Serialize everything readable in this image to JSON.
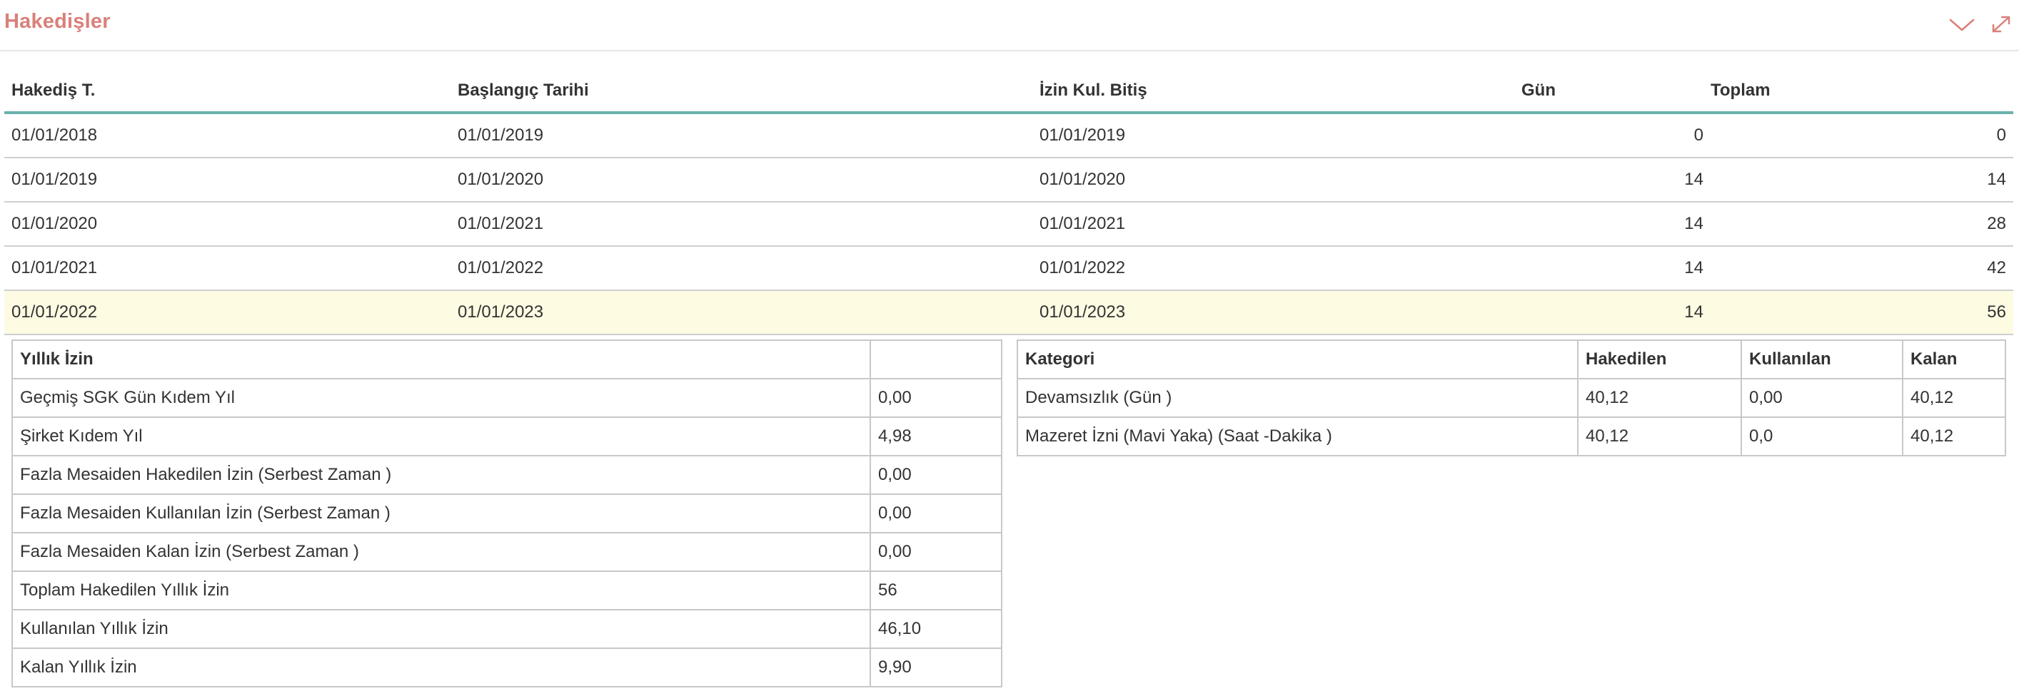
{
  "panel": {
    "title": "Hakedişler",
    "icons": {
      "collapse": "chevron-down-icon",
      "expand": "expand-arrows-icon"
    },
    "accent_color": "#d9807a",
    "header_line_color": "#6ab2ac",
    "selected_row_color": "#fdfbe2"
  },
  "hakedis": {
    "columns": [
      "Hakediş T.",
      "Başlangıç Tarihi",
      "İzin Kul. Bitiş",
      "Gün",
      "Toplam"
    ],
    "rows": [
      [
        "01/01/2018",
        "01/01/2019",
        "01/01/2019",
        "0",
        "0"
      ],
      [
        "01/01/2019",
        "01/01/2020",
        "01/01/2020",
        "14",
        "14"
      ],
      [
        "01/01/2020",
        "01/01/2021",
        "01/01/2021",
        "14",
        "28"
      ],
      [
        "01/01/2021",
        "01/01/2022",
        "01/01/2022",
        "14",
        "42"
      ],
      [
        "01/01/2022",
        "01/01/2023",
        "01/01/2023",
        "14",
        "56"
      ]
    ]
  },
  "yillik_izin": {
    "header": "Yıllık İzin",
    "header_value": "",
    "rows": [
      [
        "Geçmiş SGK Gün Kıdem Yıl",
        "0,00"
      ],
      [
        "Şirket Kıdem Yıl",
        "4,98"
      ],
      [
        "Fazla Mesaiden Hakedilen İzin (Serbest Zaman )",
        "0,00"
      ],
      [
        "Fazla Mesaiden Kullanılan İzin (Serbest Zaman )",
        "0,00"
      ],
      [
        "Fazla Mesaiden Kalan İzin (Serbest Zaman )",
        "0,00"
      ],
      [
        "Toplam Hakedilen Yıllık İzin",
        "56"
      ],
      [
        "Kullanılan Yıllık İzin",
        "46,10"
      ],
      [
        "Kalan Yıllık İzin",
        "9,90"
      ]
    ]
  },
  "kategori": {
    "columns": [
      "Kategori",
      "Hakedilen",
      "Kullanılan",
      "Kalan"
    ],
    "rows": [
      [
        "Devamsızlık (Gün )",
        "40,12",
        "0,00",
        "40,12"
      ],
      [
        "Mazeret İzni (Mavi Yaka) (Saat -Dakika )",
        "40,12",
        "0,0",
        "40,12"
      ]
    ]
  }
}
